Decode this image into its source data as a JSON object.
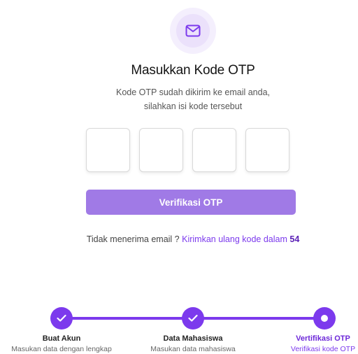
{
  "icons": {
    "mail": "mail-icon",
    "check": "check-icon"
  },
  "colors": {
    "accent": "#7c3aed",
    "button": "#a07ae6",
    "icon_bg": "#ebe1fb"
  },
  "header": {
    "title": "Masukkan Kode OTP",
    "desc_line1": "Kode OTP sudah dikirim ke email anda,",
    "desc_line2": "silahkan isi kode tersebut"
  },
  "otp": {
    "digits": [
      "",
      "",
      "",
      ""
    ]
  },
  "verify_button": {
    "label": "Verifikasi OTP"
  },
  "resend": {
    "prefix": "Tidak menerima email ?",
    "link": "Kirimkan ulang kode dalam",
    "countdown": "54"
  },
  "stepper": {
    "steps": [
      {
        "name": "Buat Akun",
        "desc": "Masukan data dengan lengkap",
        "state": "done"
      },
      {
        "name": "Data Mahasiswa",
        "desc": "Masukan data mahasiswa",
        "state": "done"
      },
      {
        "name": "Vertifikasi OTP",
        "desc": "Verifikasi kode OTP",
        "state": "current"
      }
    ]
  }
}
